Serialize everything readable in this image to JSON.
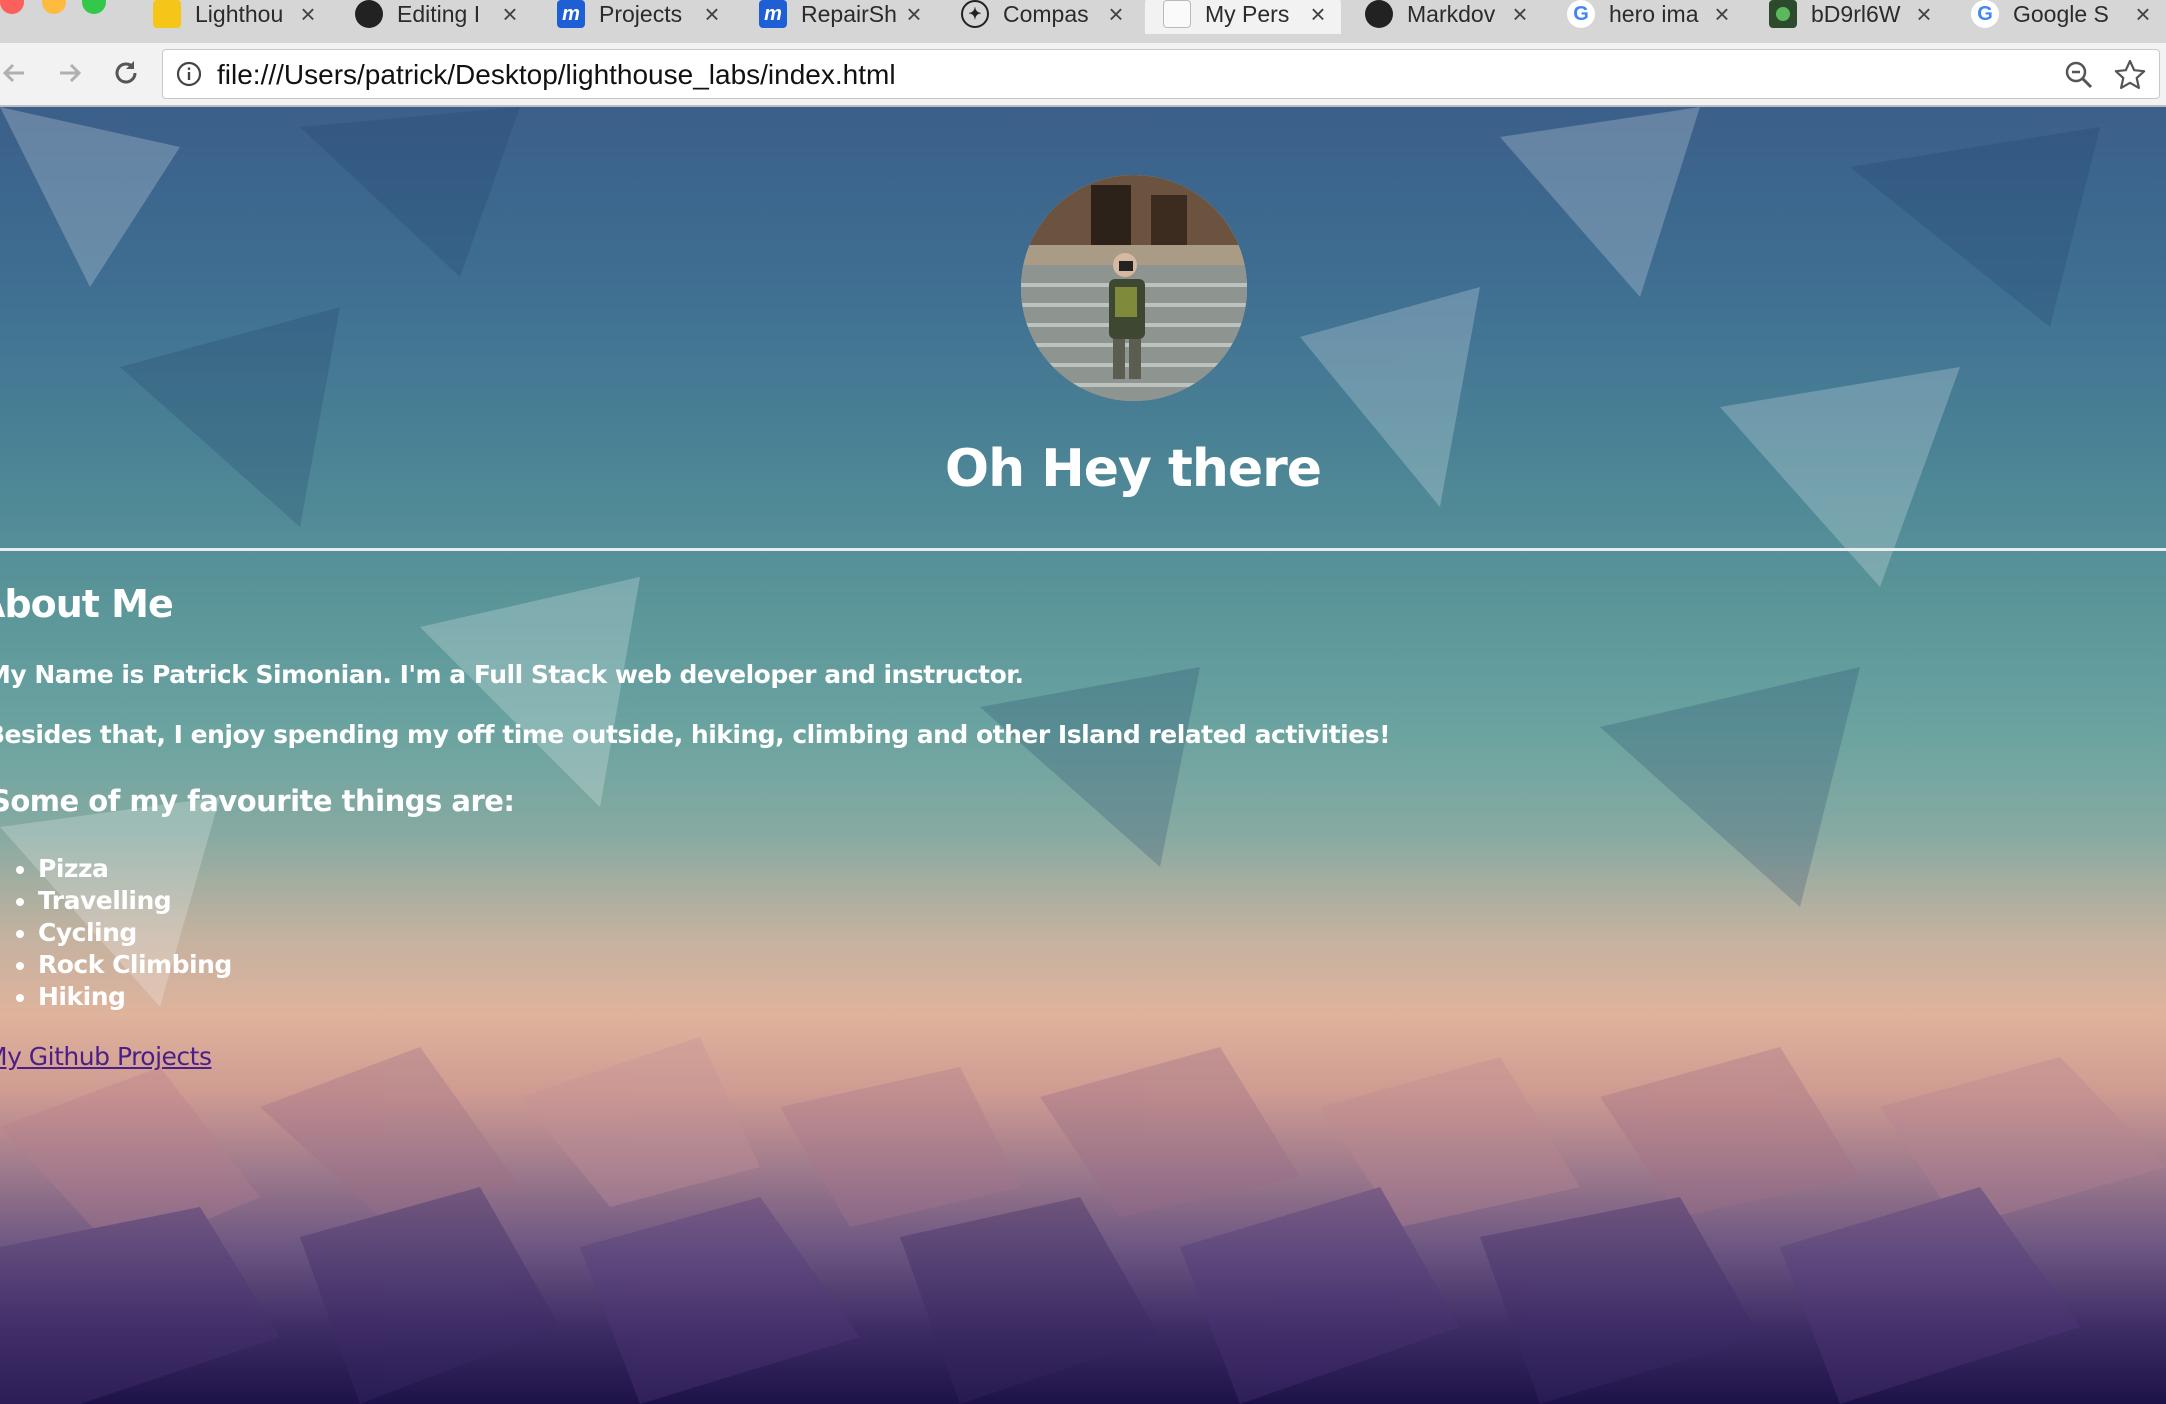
{
  "browser": {
    "tabs": [
      {
        "label": "Lighthou",
        "icon": "lighthouse-favicon-icon",
        "color": "#f5c518",
        "active": false
      },
      {
        "label": "Editing I",
        "icon": "github-icon",
        "color": "#222222",
        "active": false
      },
      {
        "label": "Projects",
        "icon": "m-icon",
        "color": "#1f5fd6",
        "active": false
      },
      {
        "label": "RepairSh",
        "icon": "m-icon",
        "color": "#1f5fd6",
        "active": false
      },
      {
        "label": "Compas",
        "icon": "compass-icon",
        "color": "#222222",
        "active": false
      },
      {
        "label": "My Pers",
        "icon": "blank-page-icon",
        "color": "#cccccc",
        "active": true
      },
      {
        "label": "Markdov",
        "icon": "github-icon",
        "color": "#222222",
        "active": false
      },
      {
        "label": "hero ima",
        "icon": "google-icon",
        "color": "#4285f4",
        "active": false
      },
      {
        "label": "bD9rl6W",
        "icon": "green-dot-icon",
        "color": "#5cb85c",
        "active": false
      },
      {
        "label": "Google S",
        "icon": "google-icon",
        "color": "#4285f4",
        "active": false
      }
    ],
    "address_bar": {
      "url": "file:///Users/patrick/Desktop/lighthouse_labs/index.html"
    }
  },
  "page": {
    "hero": {
      "title": "Oh Hey there",
      "avatar_alt": "profile photo"
    },
    "about": {
      "heading": "About Me",
      "paragraph_1": "My Name is Patrick Simonian. I'm a Full Stack web developer and instructor.",
      "paragraph_2": "Besides that, I enjoy spending my off time outside, hiking, climbing and other Island related activities!"
    },
    "favourites": {
      "heading": "Some of my favourite things are:",
      "items": [
        "Pizza",
        "Travelling",
        "Cycling",
        "Rock Climbing",
        "Hiking"
      ]
    },
    "link": {
      "label": "My Github Projects"
    }
  }
}
